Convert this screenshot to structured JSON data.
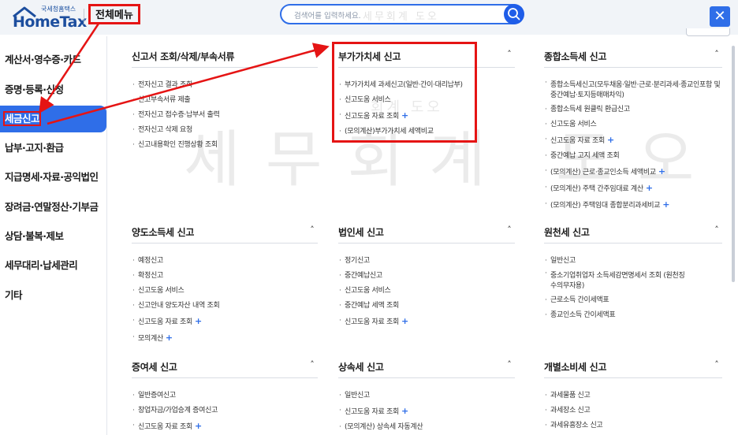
{
  "header": {
    "logo_top": "국세청홈택스",
    "logo_main": "HomeTax",
    "all_menu": "전체메뉴",
    "search_placeholder": "검색어를 입력하세요.",
    "close": "✕"
  },
  "watermark": {
    "large": "세무회계 도오",
    "small": "회계 도오",
    "search": "세무회계 도오"
  },
  "sidebar": {
    "items": [
      {
        "label": "계산서·영수증·카드"
      },
      {
        "label": "증명·등록·신청"
      },
      {
        "label": "세금신고"
      },
      {
        "label": "납부·고지·환급"
      },
      {
        "label": "지급명세·자료·공익법인"
      },
      {
        "label": "장려금·연말정산·기부금"
      },
      {
        "label": "상담·불복·제보"
      },
      {
        "label": "세무대리·납세관리"
      },
      {
        "label": "기타"
      }
    ],
    "active_index": 2
  },
  "sections": [
    {
      "title": "신고서 조회/삭제/부속서류",
      "items": [
        {
          "text": "전자신고 결과 조회"
        },
        {
          "text": "신고부속서류 제출"
        },
        {
          "text": "전자신고 접수증·납부서 출력"
        },
        {
          "text": "전자신고 삭제 요청"
        },
        {
          "text": "신고내용확인 진행상황 조회"
        }
      ]
    },
    {
      "title": "부가가치세 신고",
      "items": [
        {
          "text": "부가가치세 과세신고(일반·간이·대리납부)"
        },
        {
          "text": "신고도움 서비스"
        },
        {
          "text": "신고도움 자료 조회",
          "plus": "+"
        },
        {
          "text": "(모의계산)부가가치세 세액비교"
        }
      ]
    },
    {
      "title": "종합소득세 신고",
      "items": [
        {
          "text": "종합소득세신고(모두채움·일반·근로·분리과세·종교인포함 및 중간예납·토지등매매차익)",
          "wrap": true
        },
        {
          "text": "종합소득세 원클릭 환급신고"
        },
        {
          "text": "신고도움 서비스"
        },
        {
          "text": "신고도움 자료 조회",
          "plus": "+"
        },
        {
          "text": "중간예납 고지 세액 조회"
        },
        {
          "text": "(모의계산) 근로·종교인소득 세액비교",
          "plus": "+"
        },
        {
          "text": "(모의계산) 주택 간주임대료 계산",
          "plus": "+"
        },
        {
          "text": "(모의계산) 주택임대 종합분리과세비교",
          "plus": "+"
        }
      ]
    },
    {
      "title": "양도소득세 신고",
      "items": [
        {
          "text": "예정신고"
        },
        {
          "text": "확정신고"
        },
        {
          "text": "신고도움 서비스"
        },
        {
          "text": "신고안내 양도자산 내역 조회"
        },
        {
          "text": "신고도움 자료 조회",
          "plus": "+"
        },
        {
          "text": "모의계산",
          "plus": "+"
        }
      ]
    },
    {
      "title": "법인세 신고",
      "items": [
        {
          "text": "정기신고"
        },
        {
          "text": "중간예납신고"
        },
        {
          "text": "신고도움 서비스"
        },
        {
          "text": "중간예납 세액 조회"
        },
        {
          "text": "신고도움 자료 조회",
          "plus": "+"
        }
      ]
    },
    {
      "title": "원천세 신고",
      "items": [
        {
          "text": "일반신고"
        },
        {
          "text": "중소기업취업자 소득세감면명세서 조회 (원천징수의무자용)",
          "wrap": true
        },
        {
          "text": "근로소득 간이세액표"
        },
        {
          "text": "종교인소득 간이세액표"
        }
      ]
    },
    {
      "title": "증여세 신고",
      "items": [
        {
          "text": "일반증여신고"
        },
        {
          "text": "창업자금/가업승계 증여신고"
        },
        {
          "text": "신고도움 자료 조회",
          "plus": "+"
        }
      ]
    },
    {
      "title": "상속세 신고",
      "items": [
        {
          "text": "일반신고"
        },
        {
          "text": "신고도움 자료 조회",
          "plus": "+"
        },
        {
          "text": "(모의계산) 상속세 자동계산"
        }
      ]
    },
    {
      "title": "개별소비세 신고",
      "items": [
        {
          "text": "과세물품 신고"
        },
        {
          "text": "과세장소 신고"
        },
        {
          "text": "과세유흥장소 신고"
        }
      ]
    }
  ],
  "colors": {
    "accent": "#2f6ee8",
    "highlight": "#e51414"
  }
}
